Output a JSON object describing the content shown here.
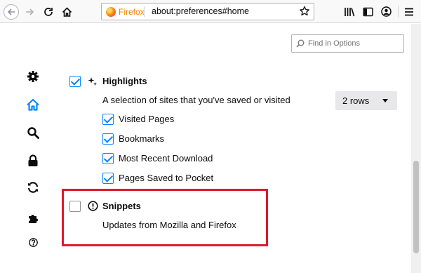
{
  "toolbar": {
    "identity_label": "Firefox",
    "url": "about:preferences#home"
  },
  "search": {
    "placeholder": "Find in Options"
  },
  "highlights": {
    "label": "Highlights",
    "description": "A selection of sites that you've saved or visited",
    "checked": true,
    "rows_value": "2 rows",
    "options": [
      {
        "label": "Visited Pages",
        "checked": true
      },
      {
        "label": "Bookmarks",
        "checked": true
      },
      {
        "label": "Most Recent Download",
        "checked": true
      },
      {
        "label": "Pages Saved to Pocket",
        "checked": true
      }
    ]
  },
  "snippets": {
    "label": "Snippets",
    "description": "Updates from Mozilla and Firefox",
    "checked": false
  },
  "categories": [
    "general-icon",
    "home-icon",
    "search-icon",
    "privacy-lock-icon",
    "sync-icon",
    "extensions-icon",
    "support-icon"
  ],
  "colors": {
    "accent": "#0a84ff",
    "annotation_box": "#e0182e",
    "identity": "#f28800"
  }
}
